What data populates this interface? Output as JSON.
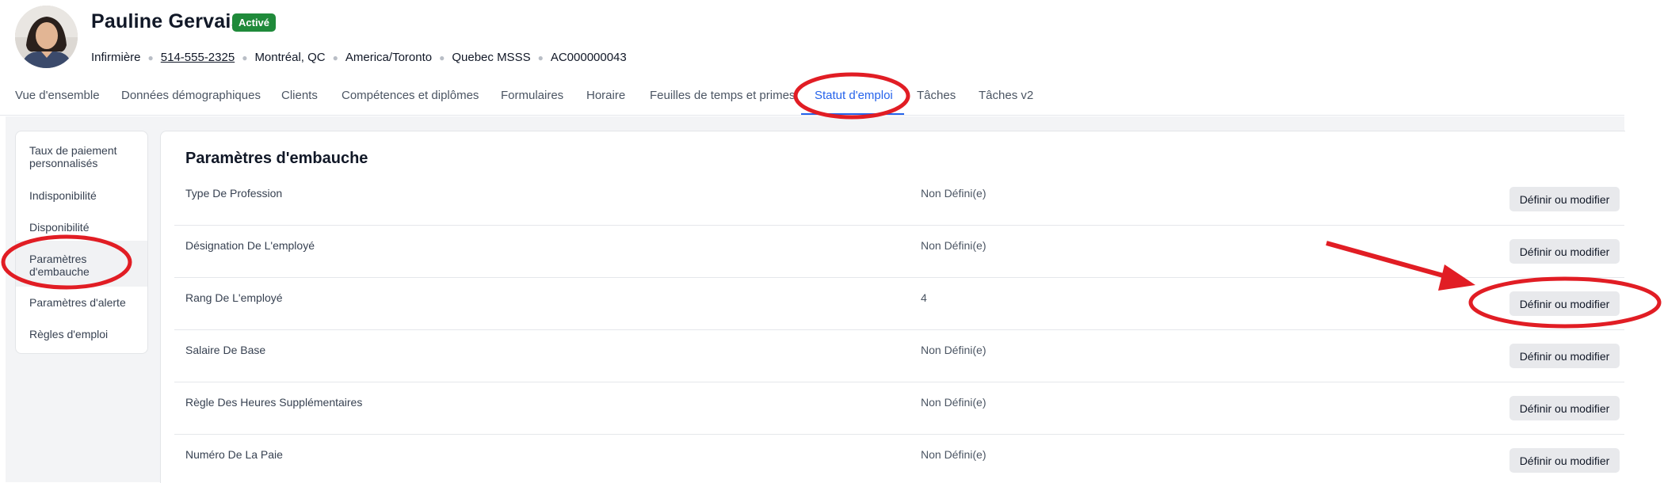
{
  "profile": {
    "name": "Pauline Gervais",
    "status": "Activé",
    "role": "Infirmière",
    "phone": "514-555-2325",
    "city": "Montréal, QC",
    "timezone": "America/Toronto",
    "organization": "Quebec MSSS",
    "id": "AC000000043"
  },
  "tabs": [
    {
      "label": "Vue d'ensemble"
    },
    {
      "label": "Données démographiques"
    },
    {
      "label": "Clients"
    },
    {
      "label": "Compétences et diplômes"
    },
    {
      "label": "Formulaires"
    },
    {
      "label": "Horaire"
    },
    {
      "label": "Feuilles de temps et primes"
    },
    {
      "label": "Statut d'emploi",
      "active": true
    },
    {
      "label": "Tâches"
    },
    {
      "label": "Tâches v2"
    }
  ],
  "sidebar": {
    "items": [
      {
        "label": "Taux de paiement personnalisés"
      },
      {
        "label": "Indisponibilité"
      },
      {
        "label": "Disponibilité"
      },
      {
        "label": "Paramètres d'embauche",
        "active": true
      },
      {
        "label": "Paramètres d'alerte"
      },
      {
        "label": "Règles d'emploi"
      }
    ]
  },
  "section": {
    "title": "Paramètres d'embauche",
    "rows": [
      {
        "label": "Type De Profession",
        "value": "Non Défini(e)",
        "button": "Définir ou modifier"
      },
      {
        "label": "Désignation De L'employé",
        "value": "Non Défini(e)",
        "button": "Définir ou modifier"
      },
      {
        "label": "Rang De L'employé",
        "value": "4",
        "button": "Définir ou modifier"
      },
      {
        "label": "Salaire De Base",
        "value": "Non Défini(e)",
        "button": "Définir ou modifier"
      },
      {
        "label": "Règle Des Heures Supplémentaires",
        "value": "Non Défini(e)",
        "button": "Définir ou modifier"
      },
      {
        "label": "Numéro De La Paie",
        "value": "Non Défini(e)",
        "button": "Définir ou modifier"
      }
    ]
  },
  "colors": {
    "accent": "#2563eb",
    "status_badge": "#1f8a3a",
    "annotation": "#e11d24"
  }
}
